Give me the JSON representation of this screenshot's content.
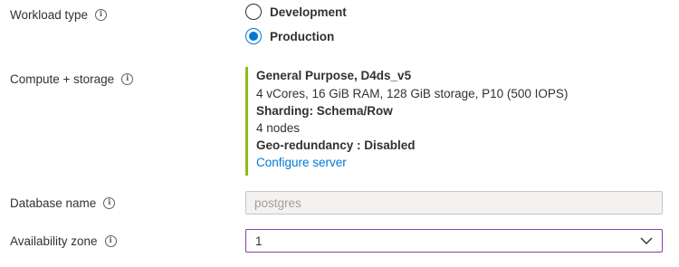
{
  "workload_type": {
    "label": "Workload type",
    "info_icon": "info-icon",
    "options": [
      {
        "label": "Development",
        "selected": false
      },
      {
        "label": "Production",
        "selected": true
      }
    ]
  },
  "compute_storage": {
    "label": "Compute + storage",
    "info_icon": "info-icon",
    "tier": "General Purpose, D4ds_v5",
    "specs": "4 vCores, 16 GiB RAM, 128 GiB storage, P10 (500 IOPS)",
    "sharding": "Sharding: Schema/Row",
    "nodes": "4 nodes",
    "geo_redundancy": "Geo-redundancy : Disabled",
    "configure_link": "Configure server",
    "accent_color": "#8cbd18"
  },
  "database_name": {
    "label": "Database name",
    "info_icon": "info-icon",
    "value": "postgres"
  },
  "availability_zone": {
    "label": "Availability zone",
    "info_icon": "info-icon",
    "value": "1",
    "icon": "chevron-down-icon"
  },
  "colors": {
    "accent_blue": "#0078d4",
    "focus_border": "#8a3ea8",
    "text": "#323130"
  }
}
